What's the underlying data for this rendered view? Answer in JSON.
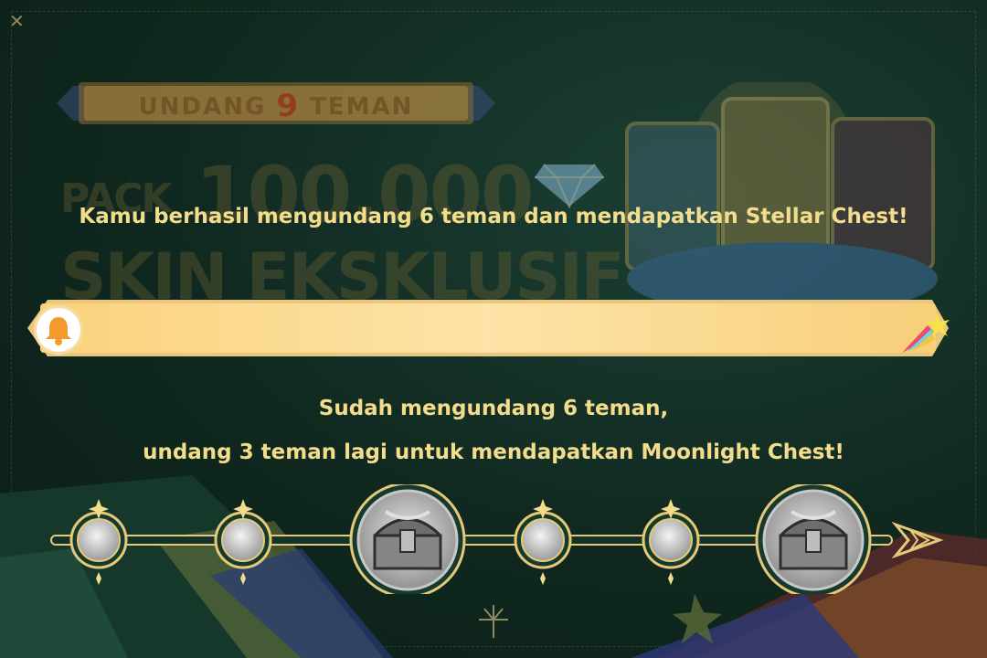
{
  "background": {
    "banner": {
      "prefix": "UNDANG",
      "number": "9",
      "suffix": "TEMAN"
    },
    "headline_line1_prefix": "PACK",
    "headline_line1_amount": "100.000",
    "headline_line2": "SKIN EKSKLUSIF"
  },
  "messages": {
    "success": "Kamu berhasil mengundang 6 teman dan mendapatkan Stellar Chest!",
    "status_line1": "Sudah mengundang 6 teman,",
    "status_line2": "undang 3 teman lagi untuk mendapatkan Moonlight Chest!"
  },
  "progress": {
    "invited": 6,
    "target": 9,
    "fill_fraction": 1.0
  },
  "milestones": [
    {
      "type": "node"
    },
    {
      "type": "node"
    },
    {
      "type": "chest",
      "name": "chest-icon"
    },
    {
      "type": "node"
    },
    {
      "type": "node"
    },
    {
      "type": "chest",
      "name": "chest-icon"
    }
  ],
  "colors": {
    "background": "#10281f",
    "text_gold": "#f3dd8c",
    "bar_fill": "#fcd98a",
    "bell": "#f39a2c"
  },
  "icons": [
    "bell-icon",
    "rocket-icon",
    "diamond-icon",
    "chest-icon",
    "firework-icon",
    "close-icon"
  ]
}
